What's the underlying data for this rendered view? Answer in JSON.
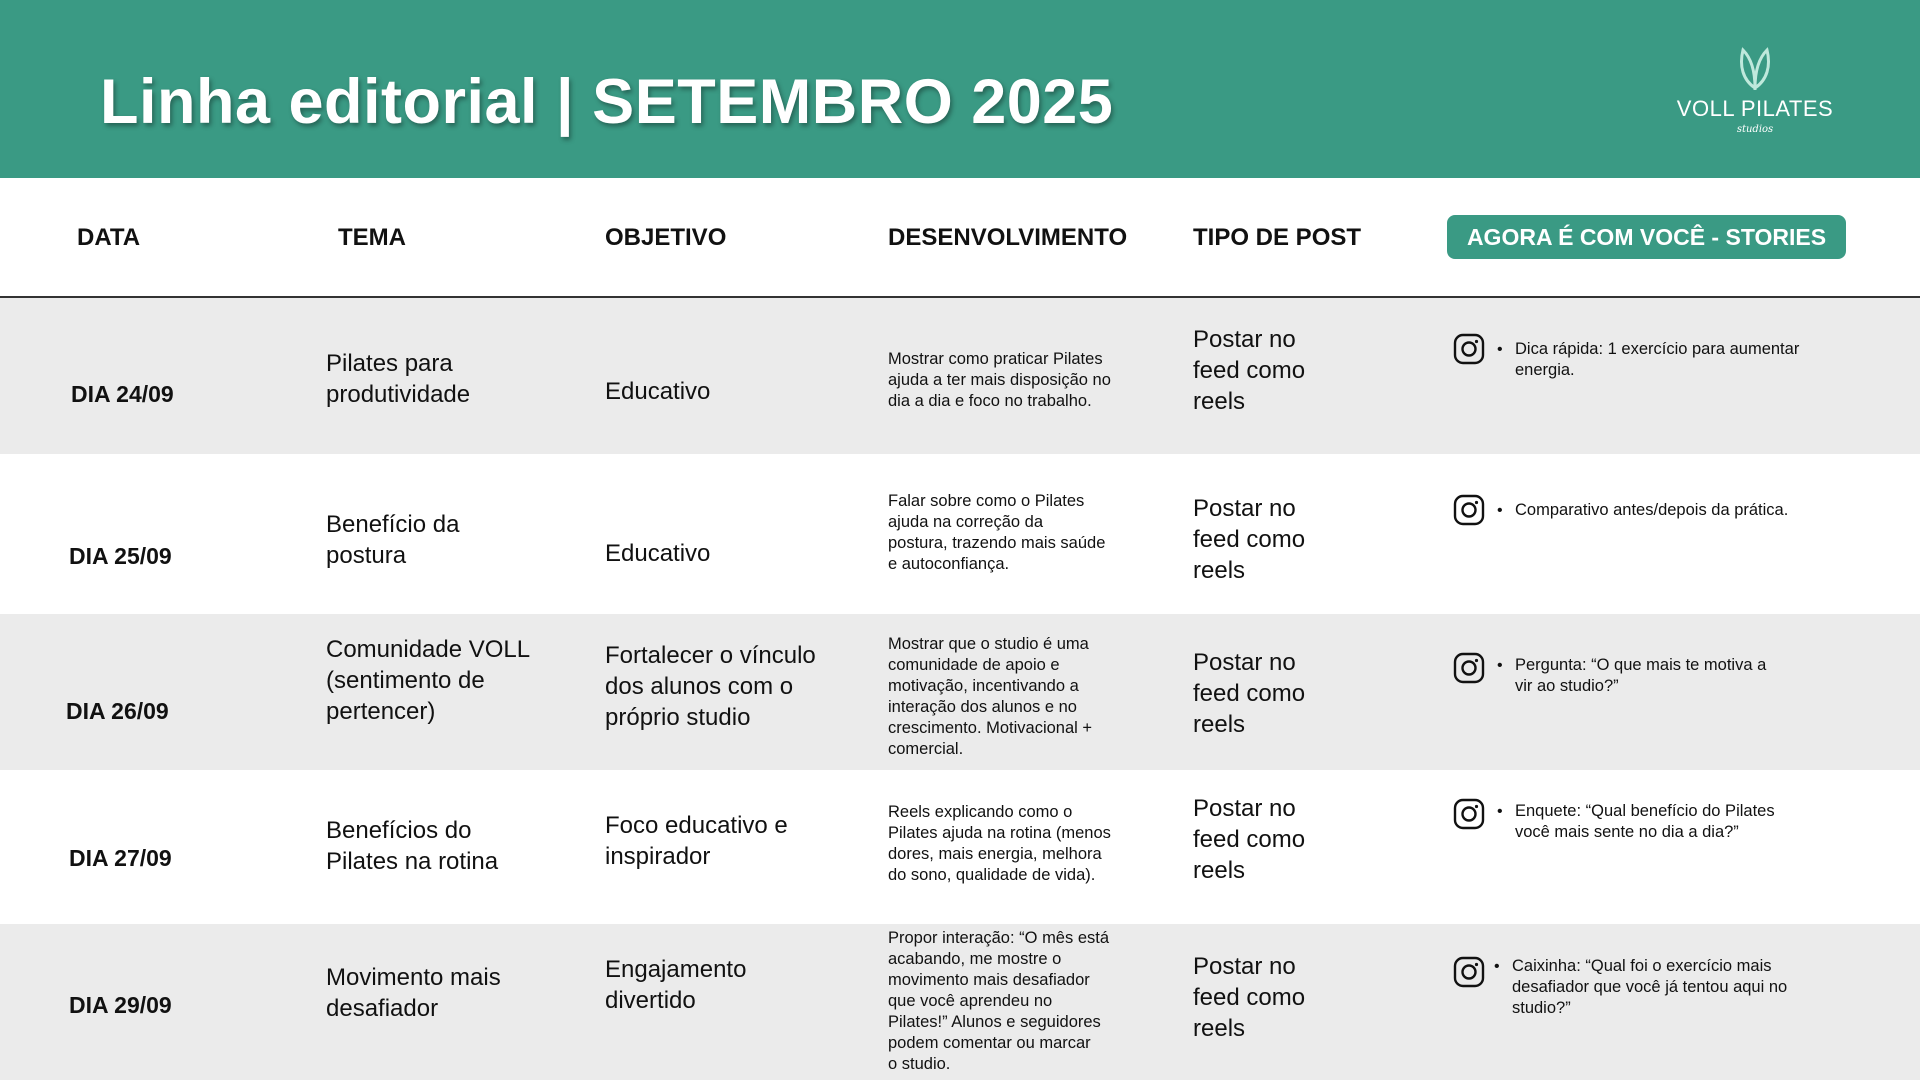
{
  "header": {
    "title": "Linha editorial | SETEMBRO 2025",
    "logo_text": "VOLL PILATES",
    "logo_sub": "studios",
    "background_color": "#3a9a84"
  },
  "columns": {
    "data": "DATA",
    "tema": "TEMA",
    "objetivo": "OBJETIVO",
    "desenvolvimento": "DESENVOLVIMENTO",
    "tipo": "TIPO DE POST",
    "stories": "AGORA É COM VOCÊ - STORIES"
  },
  "rows": [
    {
      "date": "DIA 24/09",
      "tema": [
        "Pilates para",
        "produtividade"
      ],
      "objetivo": [
        "Educativo"
      ],
      "desenvolvimento": [
        "Mostrar como praticar Pilates",
        "ajuda a ter mais disposição no",
        "dia a dia e foco no trabalho."
      ],
      "tipo": [
        "Postar no",
        "feed como",
        "reels"
      ],
      "story": [
        "Dica rápida: 1 exercício para aumentar",
        "energia."
      ],
      "story_icon": "instagram-icon"
    },
    {
      "date": "DIA 25/09",
      "tema": [
        "Benefício da",
        "postura"
      ],
      "objetivo": [
        "Educativo"
      ],
      "desenvolvimento": [
        "Falar sobre como o Pilates",
        "ajuda na correção da",
        "postura, trazendo mais saúde",
        "e autoconfiança."
      ],
      "tipo": [
        "Postar no",
        "feed como",
        "reels"
      ],
      "story": [
        "Comparativo antes/depois da prática."
      ],
      "story_icon": "instagram-icon"
    },
    {
      "date": "DIA 26/09",
      "tema": [
        "Comunidade VOLL",
        "(sentimento de",
        "pertencer)"
      ],
      "objetivo": [
        "Fortalecer o vínculo",
        "dos alunos com o",
        "próprio studio"
      ],
      "desenvolvimento": [
        "Mostrar que o studio é uma",
        "comunidade de apoio e",
        "motivação, incentivando a",
        "interação dos alunos e no",
        "crescimento. Motivacional +",
        "comercial."
      ],
      "tipo": [
        "Postar no",
        "feed como",
        "reels"
      ],
      "story": [
        "Pergunta: “O que mais te motiva a",
        "vir ao studio?”"
      ],
      "story_icon": "instagram-icon"
    },
    {
      "date": "DIA 27/09",
      "tema": [
        "Benefícios do",
        "Pilates na rotina"
      ],
      "objetivo": [
        "Foco educativo e",
        "inspirador"
      ],
      "desenvolvimento": [
        "Reels explicando como o",
        "Pilates ajuda na rotina (menos",
        "dores, mais energia, melhora",
        "do sono, qualidade de vida)."
      ],
      "tipo": [
        "Postar no",
        "feed como",
        "reels"
      ],
      "story": [
        "Enquete: “Qual benefício do Pilates",
        "você mais sente no dia a dia?”"
      ],
      "story_icon": "instagram-icon"
    },
    {
      "date": "DIA 29/09",
      "tema": [
        "Movimento mais",
        "desafiador"
      ],
      "objetivo": [
        "Engajamento",
        "divertido"
      ],
      "desenvolvimento": [
        "Propor interação: “O mês está",
        "acabando, me mostre o",
        "movimento mais desafiador",
        "que você aprendeu no",
        "Pilates!” Alunos e seguidores",
        "podem comentar ou marcar",
        "o studio."
      ],
      "tipo": [
        "Postar no",
        "feed como",
        "reels"
      ],
      "story": [
        "Caixinha: “Qual foi o exercício mais",
        "desafiador que você já tentou aqui no",
        "studio?”"
      ],
      "story_icon": "instagram-icon"
    }
  ]
}
